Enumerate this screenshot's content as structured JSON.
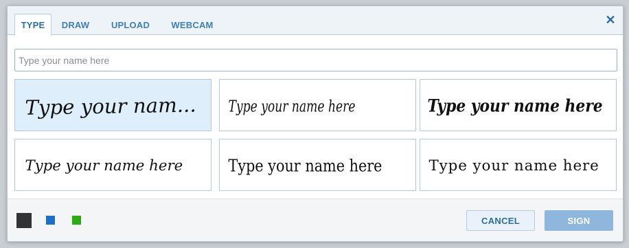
{
  "tabs": [
    {
      "label": "TYPE",
      "active": true
    },
    {
      "label": "DRAW",
      "active": false
    },
    {
      "label": "UPLOAD",
      "active": false
    },
    {
      "label": "WEBCAM",
      "active": false
    }
  ],
  "close": {
    "icon": "close-icon",
    "glyph": "✕"
  },
  "name_input": {
    "value": "",
    "placeholder": "Type your name here"
  },
  "signature_styles": [
    {
      "text": "Type your nam...",
      "selected": true
    },
    {
      "text": "Type your name here",
      "selected": false
    },
    {
      "text": "Type your name here",
      "selected": false
    },
    {
      "text": "Type your name here",
      "selected": false
    },
    {
      "text": "Type your name here",
      "selected": false
    },
    {
      "text": "Type your name here",
      "selected": false
    }
  ],
  "colors": [
    {
      "name": "black",
      "hex": "#333333",
      "selected": true
    },
    {
      "name": "blue",
      "hex": "#1f6fc4",
      "selected": false
    },
    {
      "name": "green",
      "hex": "#2bab16",
      "selected": false
    }
  ],
  "buttons": {
    "cancel": "CANCEL",
    "sign": "SIGN"
  },
  "theme": {
    "accent": "#2d6da3",
    "selected_card_bg": "#dfeefb"
  }
}
